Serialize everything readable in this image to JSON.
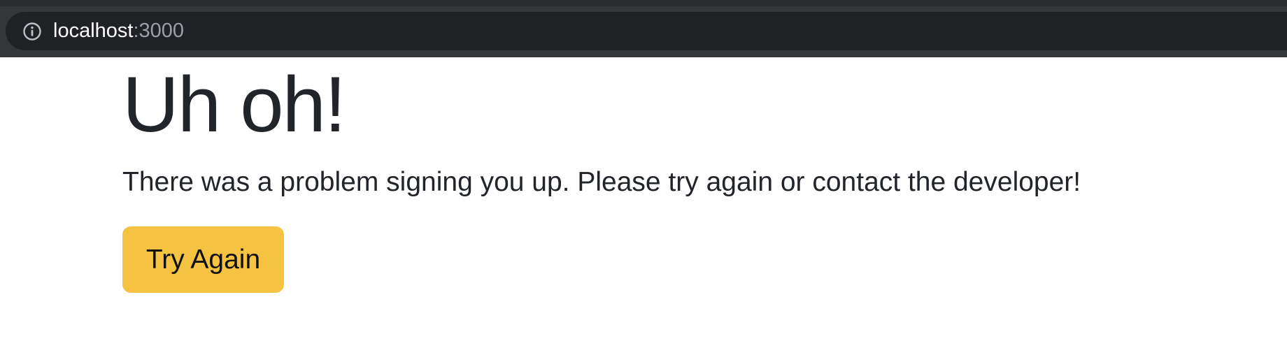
{
  "browser": {
    "address_host": "localhost",
    "address_port": ":3000",
    "info_icon": "info-icon"
  },
  "page": {
    "headline": "Uh oh!",
    "message": "There was a problem signing you up. Please try again or contact the developer!",
    "retry_label": "Try Again"
  },
  "colors": {
    "button_bg": "#f5c242",
    "text": "#212529",
    "toolbar_bg": "#35363a",
    "address_bg": "#202124"
  }
}
